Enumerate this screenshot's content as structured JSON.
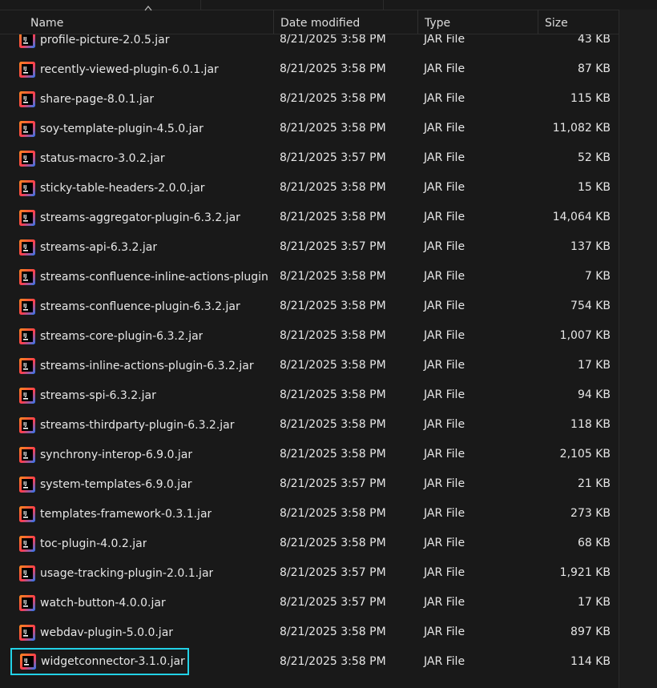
{
  "columns": {
    "name": "Name",
    "date": "Date modified",
    "type": "Type",
    "size": "Size"
  },
  "icons": {
    "file": "jar-file-icon",
    "sort": "sort-ascending-icon"
  },
  "colors": {
    "background": "#191919",
    "selection_border": "#22d1e6",
    "icon_blue": "#1f7cff",
    "icon_red": "#ff3c4e",
    "icon_orange": "#ff8a1c"
  },
  "files": [
    {
      "name": "profile-picture-2.0.5.jar",
      "date": "8/21/2025 3:58 PM",
      "type": "JAR File",
      "size": "43 KB"
    },
    {
      "name": "recently-viewed-plugin-6.0.1.jar",
      "date": "8/21/2025 3:58 PM",
      "type": "JAR File",
      "size": "87 KB"
    },
    {
      "name": "share-page-8.0.1.jar",
      "date": "8/21/2025 3:58 PM",
      "type": "JAR File",
      "size": "115 KB"
    },
    {
      "name": "soy-template-plugin-4.5.0.jar",
      "date": "8/21/2025 3:58 PM",
      "type": "JAR File",
      "size": "11,082 KB"
    },
    {
      "name": "status-macro-3.0.2.jar",
      "date": "8/21/2025 3:57 PM",
      "type": "JAR File",
      "size": "52 KB"
    },
    {
      "name": "sticky-table-headers-2.0.0.jar",
      "date": "8/21/2025 3:58 PM",
      "type": "JAR File",
      "size": "15 KB"
    },
    {
      "name": "streams-aggregator-plugin-6.3.2.jar",
      "date": "8/21/2025 3:58 PM",
      "type": "JAR File",
      "size": "14,064 KB"
    },
    {
      "name": "streams-api-6.3.2.jar",
      "date": "8/21/2025 3:57 PM",
      "type": "JAR File",
      "size": "137 KB"
    },
    {
      "name": "streams-confluence-inline-actions-plugin...",
      "date": "8/21/2025 3:58 PM",
      "type": "JAR File",
      "size": "7 KB"
    },
    {
      "name": "streams-confluence-plugin-6.3.2.jar",
      "date": "8/21/2025 3:58 PM",
      "type": "JAR File",
      "size": "754 KB"
    },
    {
      "name": "streams-core-plugin-6.3.2.jar",
      "date": "8/21/2025 3:58 PM",
      "type": "JAR File",
      "size": "1,007 KB"
    },
    {
      "name": "streams-inline-actions-plugin-6.3.2.jar",
      "date": "8/21/2025 3:58 PM",
      "type": "JAR File",
      "size": "17 KB"
    },
    {
      "name": "streams-spi-6.3.2.jar",
      "date": "8/21/2025 3:58 PM",
      "type": "JAR File",
      "size": "94 KB"
    },
    {
      "name": "streams-thirdparty-plugin-6.3.2.jar",
      "date": "8/21/2025 3:58 PM",
      "type": "JAR File",
      "size": "118 KB"
    },
    {
      "name": "synchrony-interop-6.9.0.jar",
      "date": "8/21/2025 3:58 PM",
      "type": "JAR File",
      "size": "2,105 KB"
    },
    {
      "name": "system-templates-6.9.0.jar",
      "date": "8/21/2025 3:57 PM",
      "type": "JAR File",
      "size": "21 KB"
    },
    {
      "name": "templates-framework-0.3.1.jar",
      "date": "8/21/2025 3:58 PM",
      "type": "JAR File",
      "size": "273 KB"
    },
    {
      "name": "toc-plugin-4.0.2.jar",
      "date": "8/21/2025 3:58 PM",
      "type": "JAR File",
      "size": "68 KB"
    },
    {
      "name": "usage-tracking-plugin-2.0.1.jar",
      "date": "8/21/2025 3:57 PM",
      "type": "JAR File",
      "size": "1,921 KB"
    },
    {
      "name": "watch-button-4.0.0.jar",
      "date": "8/21/2025 3:57 PM",
      "type": "JAR File",
      "size": "17 KB"
    },
    {
      "name": "webdav-plugin-5.0.0.jar",
      "date": "8/21/2025 3:58 PM",
      "type": "JAR File",
      "size": "897 KB"
    },
    {
      "name": "widgetconnector-3.1.0.jar",
      "date": "8/21/2025 3:58 PM",
      "type": "JAR File",
      "size": "114 KB",
      "selected": true
    }
  ]
}
